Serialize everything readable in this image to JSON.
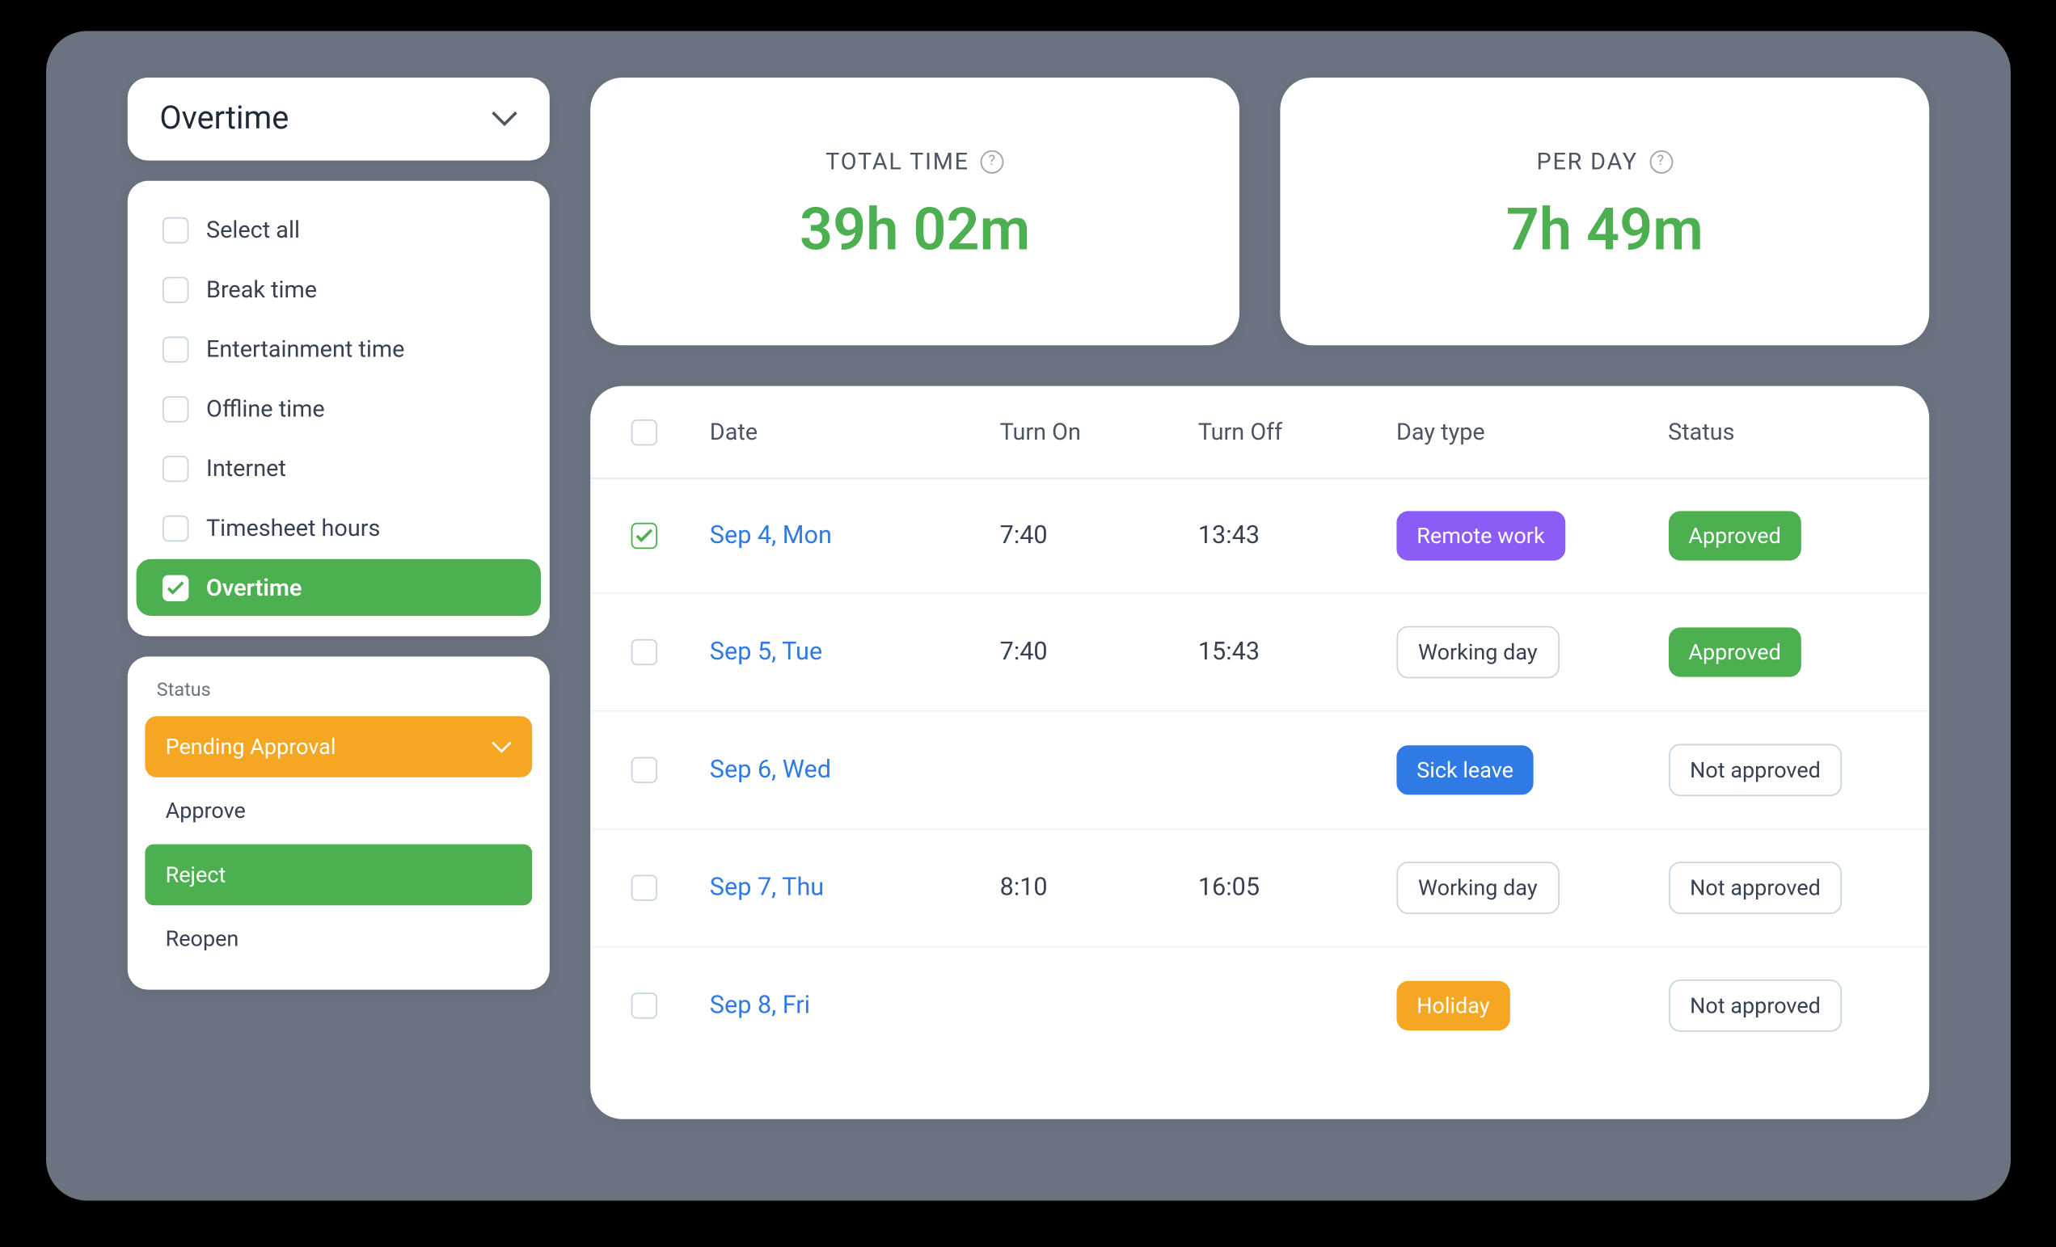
{
  "filter_dropdown": {
    "label": "Overtime"
  },
  "filter_options": [
    {
      "label": "Select all",
      "checked": false
    },
    {
      "label": "Break time",
      "checked": false
    },
    {
      "label": "Entertainment time",
      "checked": false
    },
    {
      "label": "Offline time",
      "checked": false
    },
    {
      "label": "Internet",
      "checked": false
    },
    {
      "label": "Timesheet hours",
      "checked": false
    },
    {
      "label": "Overtime",
      "checked": true
    }
  ],
  "status_panel": {
    "title": "Status",
    "selected": "Pending Approval",
    "options": [
      {
        "label": "Approve",
        "highlight": false
      },
      {
        "label": "Reject",
        "highlight": true
      },
      {
        "label": "Reopen",
        "highlight": false
      }
    ]
  },
  "stats": {
    "total_time": {
      "label": "TOTAL TIME",
      "value": "39h 02m"
    },
    "per_day": {
      "label": "PER DAY",
      "value": "7h 49m"
    }
  },
  "table": {
    "headers": {
      "date": "Date",
      "turn_on": "Turn On",
      "turn_off": "Turn Off",
      "day_type": "Day type",
      "status": "Status"
    },
    "rows": [
      {
        "checked": true,
        "date": "Sep 4, Mon",
        "on": "7:40",
        "off": "13:43",
        "day_type": "Remote work",
        "day_type_style": "purple",
        "status": "Approved",
        "status_style": "green"
      },
      {
        "checked": false,
        "date": "Sep 5, Tue",
        "on": "7:40",
        "off": "15:43",
        "day_type": "Working day",
        "day_type_style": "outline",
        "status": "Approved",
        "status_style": "green"
      },
      {
        "checked": false,
        "date": "Sep 6, Wed",
        "on": "",
        "off": "",
        "day_type": "Sick leave",
        "day_type_style": "blue",
        "status": "Not approved",
        "status_style": "outline"
      },
      {
        "checked": false,
        "date": "Sep 7, Thu",
        "on": "8:10",
        "off": "16:05",
        "day_type": "Working day",
        "day_type_style": "outline",
        "status": "Not approved",
        "status_style": "outline"
      },
      {
        "checked": false,
        "date": "Sep 8, Fri",
        "on": "",
        "off": "",
        "day_type": "Holiday",
        "day_type_style": "amber",
        "status": "Not approved",
        "status_style": "outline"
      }
    ]
  },
  "colors": {
    "green": "#4caf50",
    "purple": "#8b5cf6",
    "blue": "#2f7ae5",
    "amber": "#f5a623"
  }
}
